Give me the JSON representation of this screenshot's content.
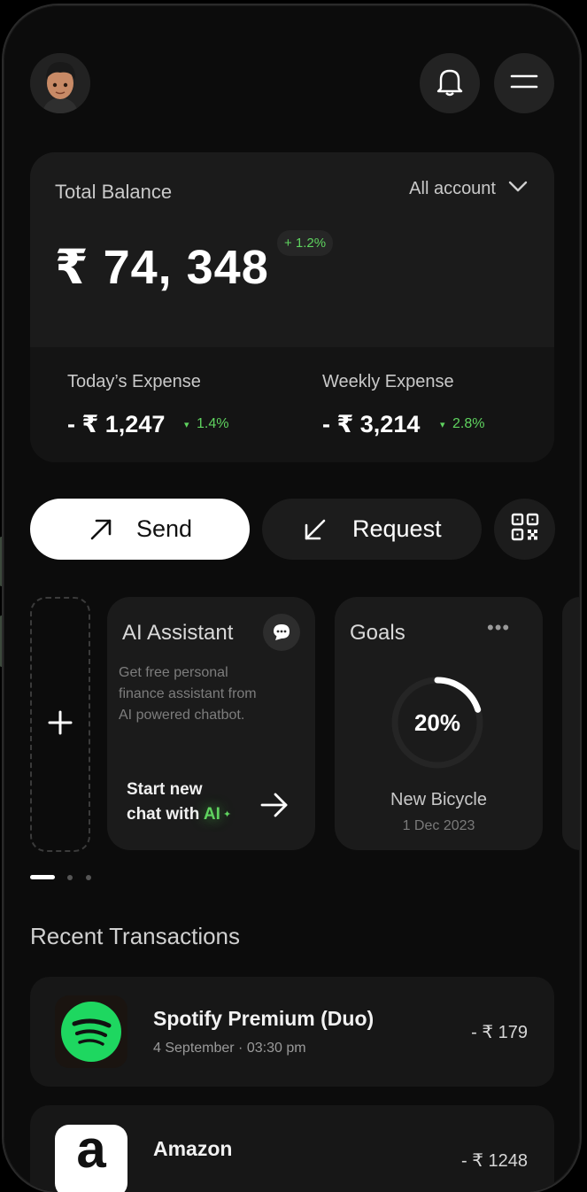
{
  "header": {
    "avatar_icon": "avatar-icon",
    "bell_icon": "bell-icon",
    "menu_icon": "hamburger-menu-icon"
  },
  "balance": {
    "label": "Total Balance",
    "account_selector": "All account",
    "amount": "₹ 74, 348",
    "change": "+ 1.2%",
    "today_label": "Today’s Expense",
    "today_value": "- ₹ 1,247",
    "today_change": "1.4%",
    "weekly_label": "Weekly Expense",
    "weekly_value": "- ₹ 3,214",
    "weekly_change": "2.8%"
  },
  "actions": {
    "send": "Send",
    "request": "Request"
  },
  "ai_card": {
    "title": "AI Assistant",
    "description_line1": "Get free personal",
    "description_line2": "finance assistant from",
    "description_line3": "AI powered chatbot.",
    "cta_line1": "Start new",
    "cta_line2": "chat with ",
    "cta_ai": "AI"
  },
  "goals_card": {
    "title": "Goals",
    "progress_label": "20%",
    "progress": 0.2,
    "goal_name": "New Bicycle",
    "goal_date": "1 Dec 2023"
  },
  "pager": {
    "active_index": 0,
    "count": 3
  },
  "recent": {
    "title": "Recent Transactions",
    "items": [
      {
        "name": "Spotify Premium (Duo)",
        "date": "4 September · 03:30 pm",
        "amount": "- ₹ 179",
        "icon": "spotify-icon"
      },
      {
        "name": "Amazon",
        "date": "",
        "amount": "- ₹ 1248",
        "icon": "amazon-icon"
      }
    ]
  },
  "colors": {
    "accent_green": "#5fd35f",
    "spotify_green": "#1ed760",
    "background": "#0c0c0c"
  }
}
